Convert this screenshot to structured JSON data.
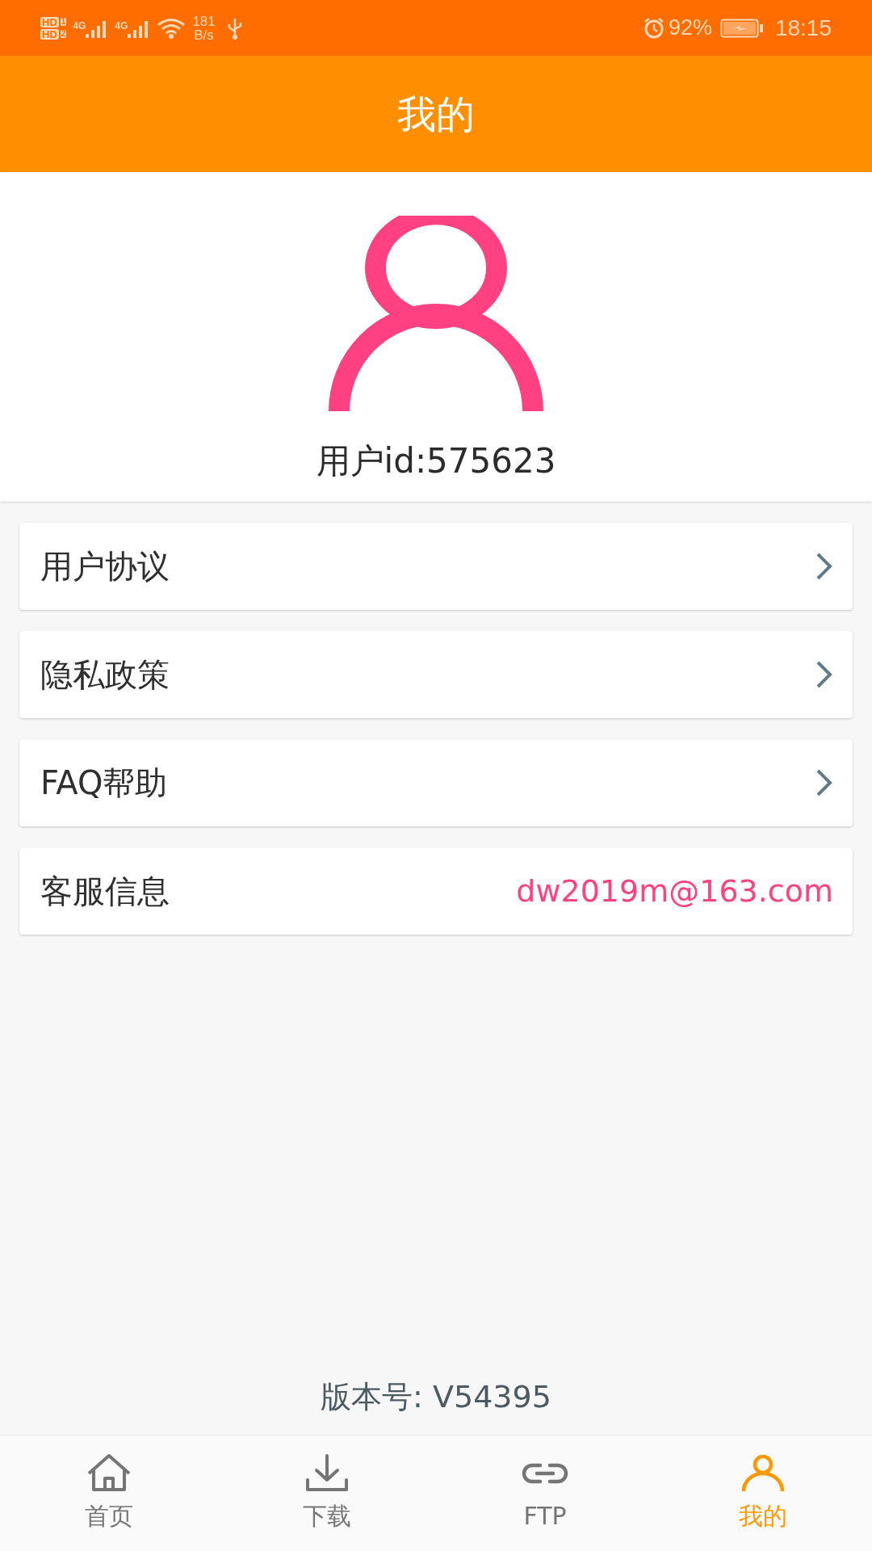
{
  "status_bar": {
    "sim_badges": [
      {
        "label": "HD",
        "slot": "1"
      },
      {
        "label": "HD",
        "slot": "2"
      }
    ],
    "networks": [
      "4G",
      "4G"
    ],
    "speed_value": "181",
    "speed_unit": "B/s",
    "battery_percent": "92%",
    "time": "18:15"
  },
  "header": {
    "title": "我的"
  },
  "profile": {
    "user_id": "用户id:575623"
  },
  "menu": [
    {
      "kind": "link",
      "label": "用户协议"
    },
    {
      "kind": "link",
      "label": "隐私政策"
    },
    {
      "kind": "link",
      "label": "FAQ帮助"
    },
    {
      "kind": "info",
      "label": "客服信息",
      "value": "dw2019m@163.com"
    }
  ],
  "version": "版本号: V54395",
  "tabs": [
    {
      "kind": "home",
      "label": "首页",
      "selected": false
    },
    {
      "kind": "download",
      "label": "下载",
      "selected": false
    },
    {
      "kind": "link",
      "label": "FTP",
      "selected": false
    },
    {
      "kind": "person",
      "label": "我的",
      "selected": true
    }
  ]
}
